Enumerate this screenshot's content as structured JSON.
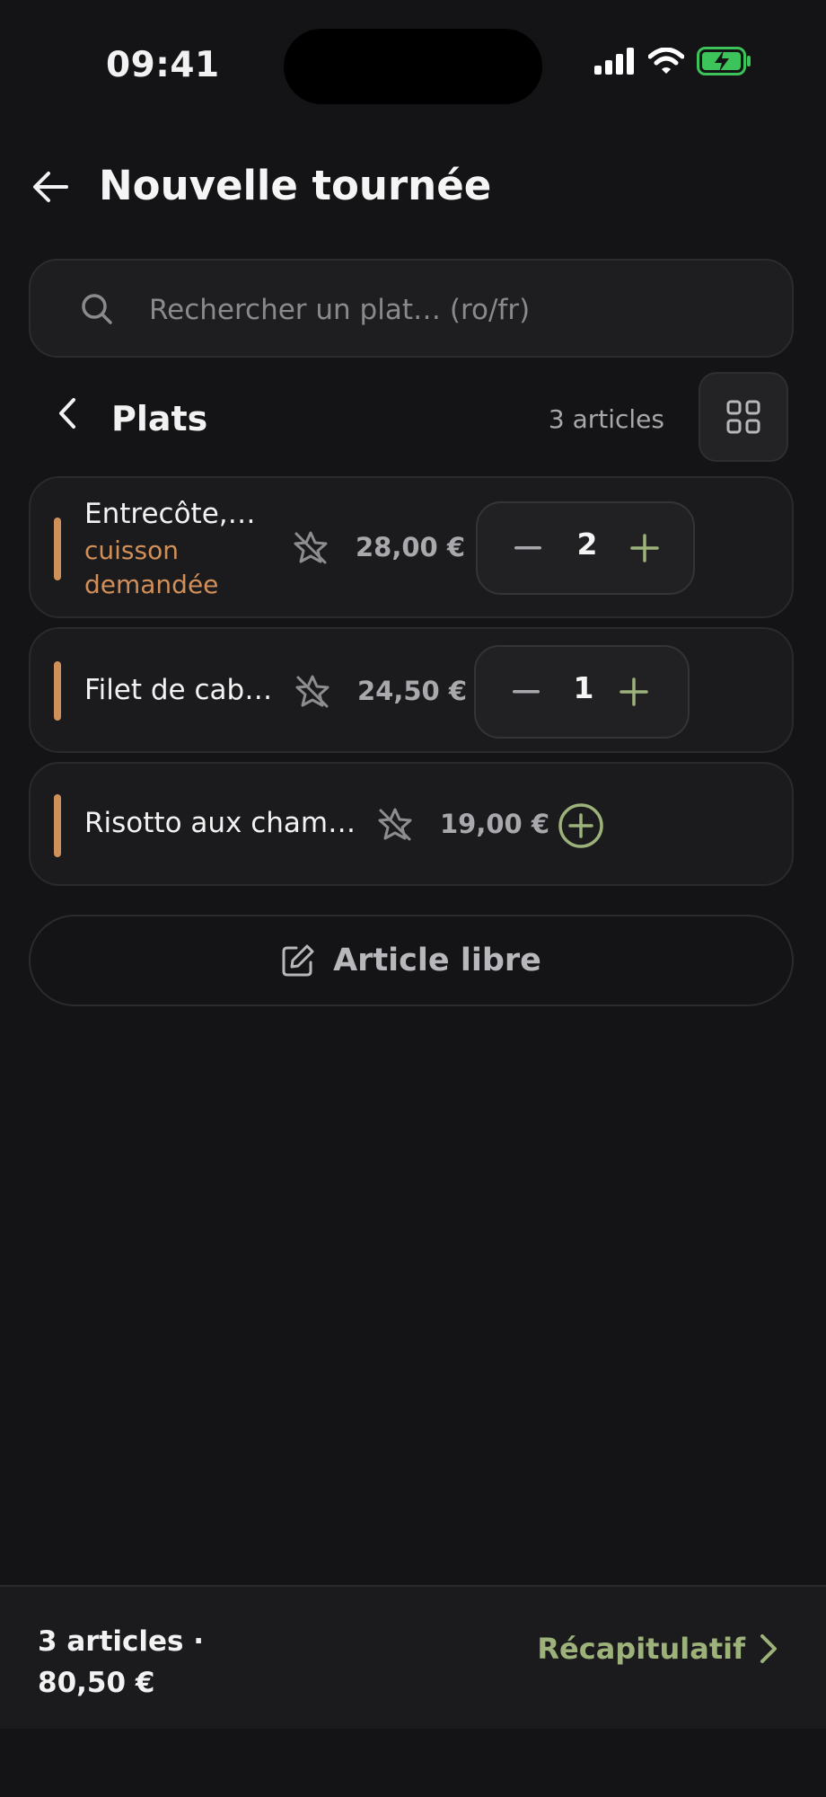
{
  "status_bar": {
    "time": "09:41"
  },
  "header": {
    "title": "Nouvelle tournée"
  },
  "search": {
    "placeholder": "Rechercher un plat… (ro/fr)",
    "value": ""
  },
  "category": {
    "title": "Plats",
    "count": "3 articles"
  },
  "items": [
    {
      "name": "Entrecôte, …",
      "note": "cuisson demandée",
      "price": "28,00 €",
      "qty": "2"
    },
    {
      "name": "Filet de cab…",
      "price": "24,50 €",
      "qty": "1"
    },
    {
      "name": "Risotto aux cham…",
      "price": "19,00 €"
    }
  ],
  "free_item": {
    "label": "Article libre"
  },
  "footer": {
    "summary_line1": "3 articles ·",
    "summary_line2": "80,50 €",
    "recap_label": "Récapitulatif"
  },
  "colors": {
    "accent": "#d0905a",
    "green": "#9db27a",
    "background": "#141416"
  }
}
